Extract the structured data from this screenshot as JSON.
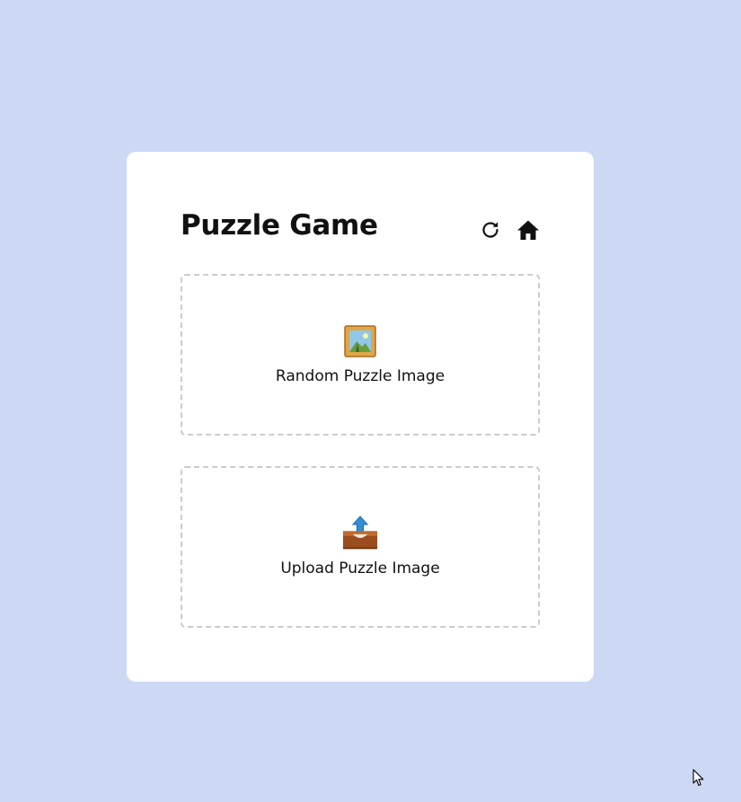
{
  "page": {
    "background_color": "#cdd8f5"
  },
  "card": {
    "title": "Puzzle Game",
    "actions": [
      {
        "icon": "refresh-icon"
      },
      {
        "icon": "home-icon"
      }
    ],
    "options": [
      {
        "label": "Random Puzzle Image",
        "icon": "framed-picture-icon"
      },
      {
        "label": "Upload Puzzle Image",
        "icon": "upload-tray-icon"
      }
    ]
  }
}
